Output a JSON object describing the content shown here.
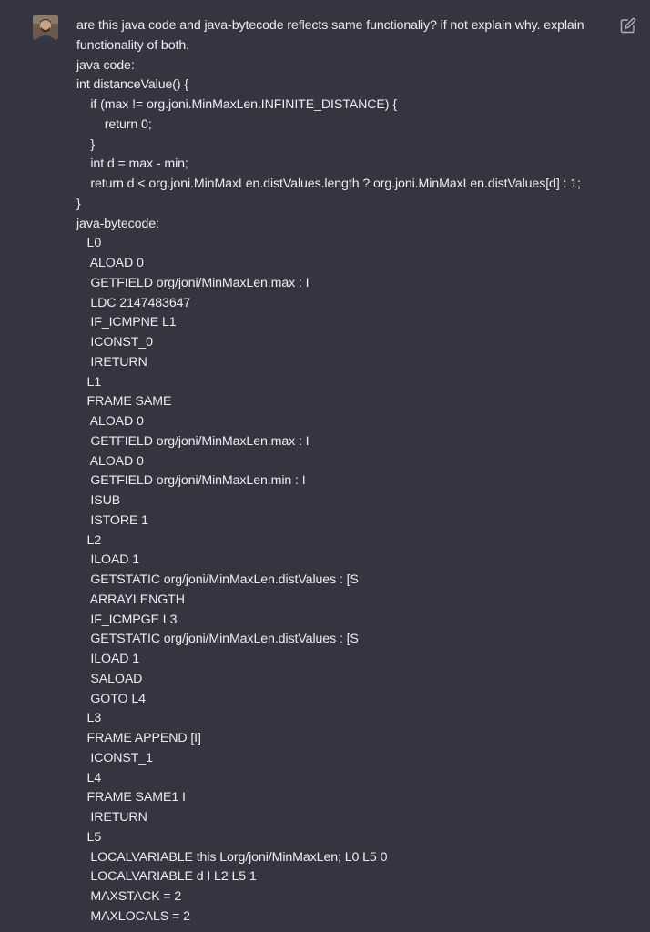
{
  "message": {
    "author_avatar": "user-avatar-photo",
    "edit_icon": "edit-icon",
    "lines": [
      "are this java code and java-bytecode reflects same functionaliy? if not explain why. explain",
      "functionality of both.",
      "java code:",
      "int distanceValue() {",
      "    if (max != org.joni.MinMaxLen.INFINITE_DISTANCE) {",
      "        return 0;",
      "    }",
      "    int d = max - min;",
      "    return d < org.joni.MinMaxLen.distValues.length ? org.joni.MinMaxLen.distValues[d] : 1;",
      "}",
      "java-bytecode:",
      "   L0",
      "    ALOAD 0",
      "    GETFIELD org/joni/MinMaxLen.max : I",
      "    LDC 2147483647",
      "    IF_ICMPNE L1",
      "    ICONST_0",
      "    IRETURN",
      "   L1",
      "   FRAME SAME",
      "    ALOAD 0",
      "    GETFIELD org/joni/MinMaxLen.max : I",
      "    ALOAD 0",
      "    GETFIELD org/joni/MinMaxLen.min : I",
      "    ISUB",
      "    ISTORE 1",
      "   L2",
      "    ILOAD 1",
      "    GETSTATIC org/joni/MinMaxLen.distValues : [S",
      "    ARRAYLENGTH",
      "    IF_ICMPGE L3",
      "    GETSTATIC org/joni/MinMaxLen.distValues : [S",
      "    ILOAD 1",
      "    SALOAD",
      "    GOTO L4",
      "   L3",
      "   FRAME APPEND [I]",
      "    ICONST_1",
      "   L4",
      "   FRAME SAME1 I",
      "    IRETURN",
      "   L5",
      "    LOCALVARIABLE this Lorg/joni/MinMaxLen; L0 L5 0",
      "    LOCALVARIABLE d I L2 L5 1",
      "    MAXSTACK = 2",
      "    MAXLOCALS = 2"
    ]
  }
}
